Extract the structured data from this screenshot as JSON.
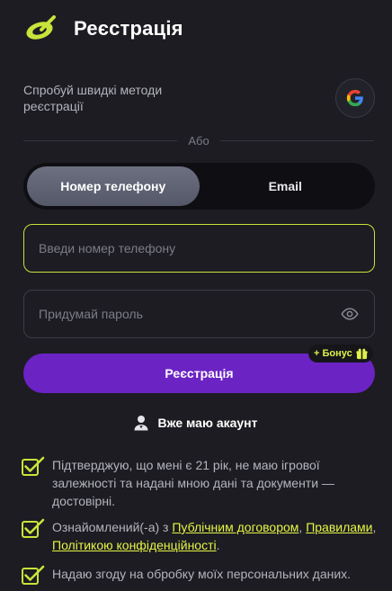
{
  "header": {
    "title": "Реєстрація"
  },
  "quick": {
    "text": "Спробуй швидкі методи реєстрації",
    "google_icon": "google-icon"
  },
  "divider": {
    "label": "Або"
  },
  "tabs": [
    {
      "label": "Номер телефону",
      "active": true
    },
    {
      "label": "Email",
      "active": false
    }
  ],
  "phone_field": {
    "placeholder": "Введи номер телефону",
    "value": ""
  },
  "password_field": {
    "placeholder": "Придумай пароль",
    "value": ""
  },
  "register_button": {
    "label": "Реєстрація"
  },
  "bonus_badge": {
    "label": "+ Бонус"
  },
  "have_account": {
    "label": "Вже маю акаунт"
  },
  "consents": {
    "age": {
      "text": "Підтверджую, що мені є 21 рік, не маю ігрової залежності та надані мною дані та документи — достовірні.",
      "checked": true
    },
    "terms": {
      "prefix": "Ознайомлений(-а) з ",
      "link1": "Публічним договором",
      "sep1": ", ",
      "link2": "Правилами",
      "sep2": ", ",
      "link3": "Політикою конфіденційності",
      "suffix": ".",
      "checked": true
    },
    "personal": {
      "text": "Надаю згоду на обробку моїх персональних даних.",
      "checked": true
    }
  },
  "colors": {
    "accent": "#c8e33a",
    "primary": "#6b23c4",
    "background": "#1c1c22",
    "link": "#e7f545"
  }
}
